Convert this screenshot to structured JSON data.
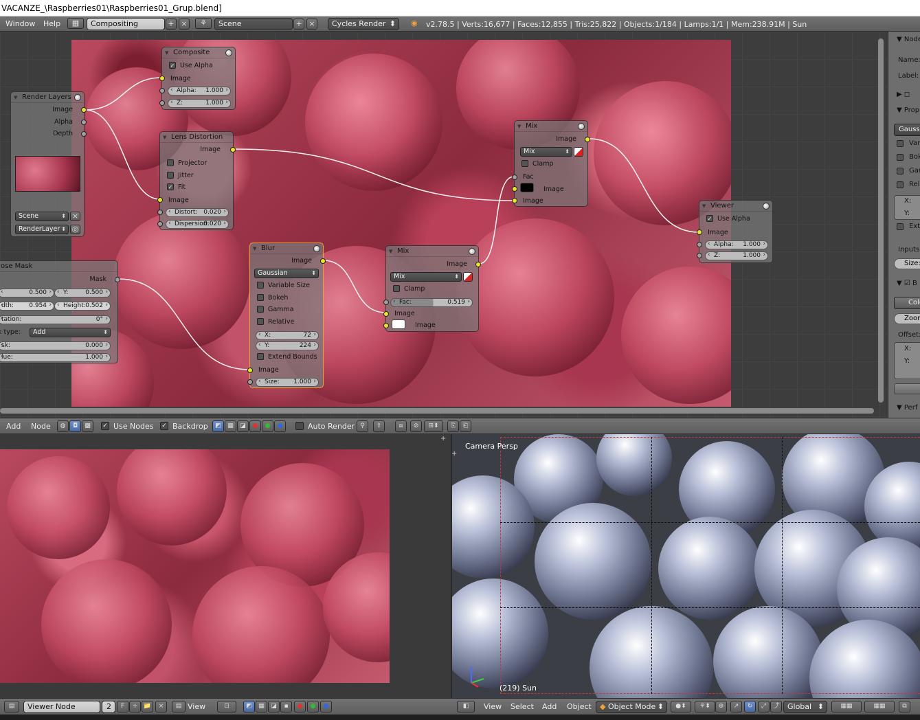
{
  "title_bar": "VACANZE_\\Raspberries01\\Raspberries01_Grup.blend]",
  "info_header": {
    "menus": [
      "Window",
      "Help"
    ],
    "screen_layout": "Compositing",
    "scene": "Scene",
    "render_engine": "Cycles Render",
    "stats": "v2.78.5 | Verts:16,677 | Faces:12,855 | Tris:25,822 | Objects:1/184 | Lamps:1/1 | Mem:238.91M | Sun"
  },
  "nodes": {
    "composite": {
      "title": "Composite",
      "use_alpha": "Use Alpha",
      "image": "Image",
      "alpha_label": "Alpha:",
      "alpha_value": "1.000",
      "z_label": "Z:",
      "z_value": "1.000"
    },
    "render_layers": {
      "title": "Render Layers",
      "out_image": "Image",
      "out_alpha": "Alpha",
      "out_depth": "Depth",
      "scene": "Scene",
      "layer": "RenderLayer"
    },
    "lens_distortion": {
      "title": "Lens Distortion",
      "out_image": "Image",
      "projector": "Projector",
      "jitter": "Jitter",
      "fit": "Fit",
      "in_image": "Image",
      "distort_label": "Distort:",
      "distort_value": "0.020",
      "dispersion_label": "Dispersion:",
      "dispersion_value": "0.020"
    },
    "mix_top": {
      "title": "Mix",
      "out_image": "Image",
      "blend": "Mix",
      "clamp": "Clamp",
      "fac": "Fac",
      "image1": "Image",
      "image2": "Image"
    },
    "viewer": {
      "title": "Viewer",
      "use_alpha": "Use Alpha",
      "image": "Image",
      "alpha_label": "Alpha:",
      "alpha_value": "1.000",
      "z_label": "Z:",
      "z_value": "1.000"
    },
    "ellipse_mask": {
      "title": "ose Mask",
      "out_mask": "Mask",
      "x_value": "0.500",
      "y_label": "Y:",
      "y_value": "0.500",
      "width_label": "dth:",
      "width_value": "0.954",
      "height_label": "Height:",
      "height_value": "0.502",
      "rotation_label": "tation:",
      "rotation_value": "0°",
      "mask_type_label": "k type:",
      "mask_type_value": "Add",
      "mask_label": "sk:",
      "mask_value": "0.000",
      "value_label": "lue:",
      "value_value": "1.000"
    },
    "blur": {
      "title": "Blur",
      "out_image": "Image",
      "filter": "Gaussian",
      "variable_size": "Variable Size",
      "bokeh": "Bokeh",
      "gamma": "Gamma",
      "relative": "Relative",
      "x_label": "X:",
      "x_value": "72",
      "y_label": "Y:",
      "y_value": "224",
      "extend_bounds": "Extend Bounds",
      "in_image": "Image",
      "size_label": "Size:",
      "size_value": "1.000"
    },
    "mix_mid": {
      "title": "Mix",
      "out_image": "Image",
      "blend": "Mix",
      "clamp": "Clamp",
      "fac_label": "Fac:",
      "fac_value": "0.519",
      "image1": "Image",
      "image2": "Image"
    }
  },
  "properties_panel": {
    "node_header": "Node",
    "name_label": "Name:",
    "label_label": "Label:",
    "props_header": "Prop",
    "filter": "Gaussi",
    "opts": [
      "Var",
      "Bok",
      "Gar",
      "Rela"
    ],
    "x_label": "X:",
    "y_label": "Y:",
    "ext": "Ext",
    "inputs_label": "Inputs:",
    "size_label": "Size:",
    "color_label": "Colo",
    "zoom_label": "Zoom",
    "offset_label": "Offset:",
    "ox": "X:",
    "oy": "Y:",
    "perf": "Perf"
  },
  "node_header": {
    "menus": [
      "Add",
      "Node"
    ],
    "use_nodes": "Use Nodes",
    "backdrop": "Backdrop",
    "auto_render": "Auto Render"
  },
  "image_header": {
    "image_name": "Viewer Node",
    "users": "2",
    "fake": "F",
    "view": "View"
  },
  "viewport": {
    "camera_label": "Camera Persp",
    "frame_label": "(219) Sun",
    "menus": [
      "View",
      "Select",
      "Add",
      "Object"
    ],
    "mode": "Object Mode",
    "orientation": "Global"
  },
  "colors": {
    "header": "#6a6a6a",
    "socket_yellow": "#e6e62c",
    "socket_gray": "#a0a0a0",
    "selected": "#f0a030"
  }
}
